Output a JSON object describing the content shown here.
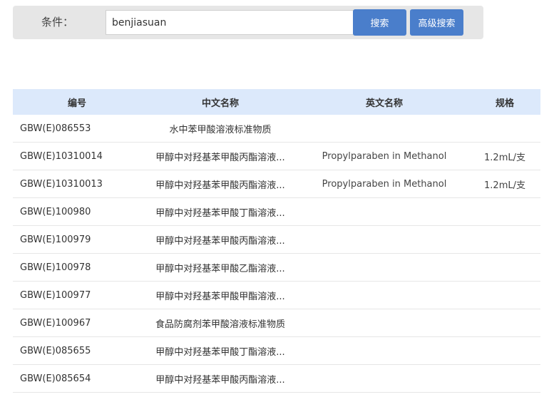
{
  "search": {
    "label": "条件：",
    "value": "benjiasuan",
    "search_button": "搜索",
    "advanced_button": "高级搜索"
  },
  "table": {
    "headers": {
      "code": "编号",
      "chinese_name": "中文名称",
      "english_name": "英文名称",
      "spec": "规格"
    },
    "rows": [
      {
        "code": "GBW(E)086553",
        "chinese_name": "水中苯甲酸溶液标准物质",
        "english_name": "",
        "spec": ""
      },
      {
        "code": "GBW(E)10310014",
        "chinese_name": "甲醇中对羟基苯甲酸丙酯溶液...",
        "english_name": "Propylparaben in Methanol",
        "spec": "1.2mL/支"
      },
      {
        "code": "GBW(E)10310013",
        "chinese_name": "甲醇中对羟基苯甲酸丙酯溶液...",
        "english_name": "Propylparaben in Methanol",
        "spec": "1.2mL/支"
      },
      {
        "code": "GBW(E)100980",
        "chinese_name": "甲醇中对羟基苯甲酸丁酯溶液...",
        "english_name": "",
        "spec": ""
      },
      {
        "code": "GBW(E)100979",
        "chinese_name": "甲醇中对羟基苯甲酸丙酯溶液...",
        "english_name": "",
        "spec": ""
      },
      {
        "code": "GBW(E)100978",
        "chinese_name": "甲醇中对羟基苯甲酸乙酯溶液...",
        "english_name": "",
        "spec": ""
      },
      {
        "code": "GBW(E)100977",
        "chinese_name": "甲醇中对羟基苯甲酸甲酯溶液...",
        "english_name": "",
        "spec": ""
      },
      {
        "code": "GBW(E)100967",
        "chinese_name": "食品防腐剂苯甲酸溶液标准物质",
        "english_name": "",
        "spec": ""
      },
      {
        "code": "GBW(E)085655",
        "chinese_name": "甲醇中对羟基苯甲酸丁酯溶液...",
        "english_name": "",
        "spec": ""
      },
      {
        "code": "GBW(E)085654",
        "chinese_name": "甲醇中对羟基苯甲酸丙酯溶液...",
        "english_name": "",
        "spec": ""
      }
    ]
  },
  "colors": {
    "button": "#4a7ecb",
    "header_bg": "#dce9fb",
    "search_bar_bg": "#e6e6e6"
  }
}
